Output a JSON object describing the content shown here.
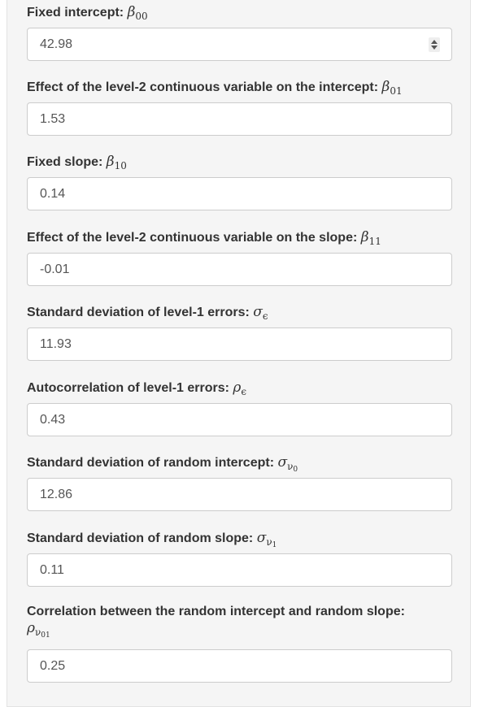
{
  "fields": [
    {
      "label": "Fixed intercept: ",
      "sym": "β",
      "sub": "00",
      "subsub": "",
      "value": "42.98"
    },
    {
      "label": "Effect of the level-2 continuous variable on the intercept: ",
      "sym": "β",
      "sub": "01",
      "subsub": "",
      "value": "1.53"
    },
    {
      "label": "Fixed slope: ",
      "sym": "β",
      "sub": "10",
      "subsub": "",
      "value": "0.14"
    },
    {
      "label": "Effect of the level-2 continuous variable on the slope: ",
      "sym": "β",
      "sub": "11",
      "subsub": "",
      "value": "-0.01"
    },
    {
      "label": "Standard deviation of level-1 errors: ",
      "sym": "σ",
      "sub": "ϵ",
      "subsub": "",
      "value": "11.93"
    },
    {
      "label": "Autocorrelation of level-1 errors: ",
      "sym": "ρ",
      "sub": "ϵ",
      "subsub": "",
      "value": "0.43"
    },
    {
      "label": "Standard deviation of random intercept: ",
      "sym": "σ",
      "sub": "ν",
      "subsub": "0",
      "value": "12.86"
    },
    {
      "label": "Standard deviation of random slope: ",
      "sym": "σ",
      "sub": "ν",
      "subsub": "1",
      "value": "0.11"
    },
    {
      "label": "Correlation between the random intercept and random slope:",
      "sym": "ρ",
      "sub": "ν",
      "subsub": "01",
      "value": "0.25"
    }
  ]
}
